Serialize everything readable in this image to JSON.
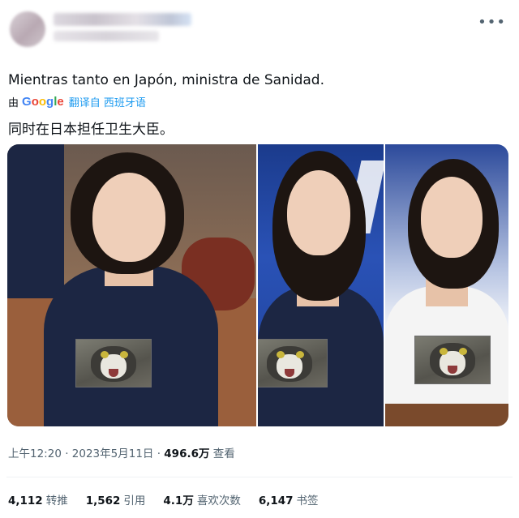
{
  "tweet": {
    "more_icon": "more-horizontal-icon",
    "original_text": "Mientras tanto en Japón, ministra de Sanidad.",
    "translation": {
      "by_prefix": "由",
      "provider": "Google",
      "provider_colors": [
        "#4285F4",
        "#EA4335",
        "#FBBC05",
        "#4285F4",
        "#34A853",
        "#EA4335"
      ],
      "action": "翻译自 西班牙语"
    },
    "translated_text": "同时在日本担任卫生大臣。"
  },
  "media": {
    "panels": [
      {
        "sticker": "cat-sticker"
      },
      {
        "sticker": "cat-sticker"
      },
      {
        "sticker": "cat-sticker"
      }
    ]
  },
  "meta": {
    "time": "上午12:20",
    "separator1": " · ",
    "date": "2023年5月11日",
    "separator2": " · ",
    "views_count": "496.6万",
    "views_label": " 查看"
  },
  "stats": [
    {
      "count": "4,112",
      "label": "转推"
    },
    {
      "count": "1,562",
      "label": "引用"
    },
    {
      "count": "4.1万",
      "label": "喜欢次数"
    },
    {
      "count": "6,147",
      "label": "书签"
    }
  ]
}
